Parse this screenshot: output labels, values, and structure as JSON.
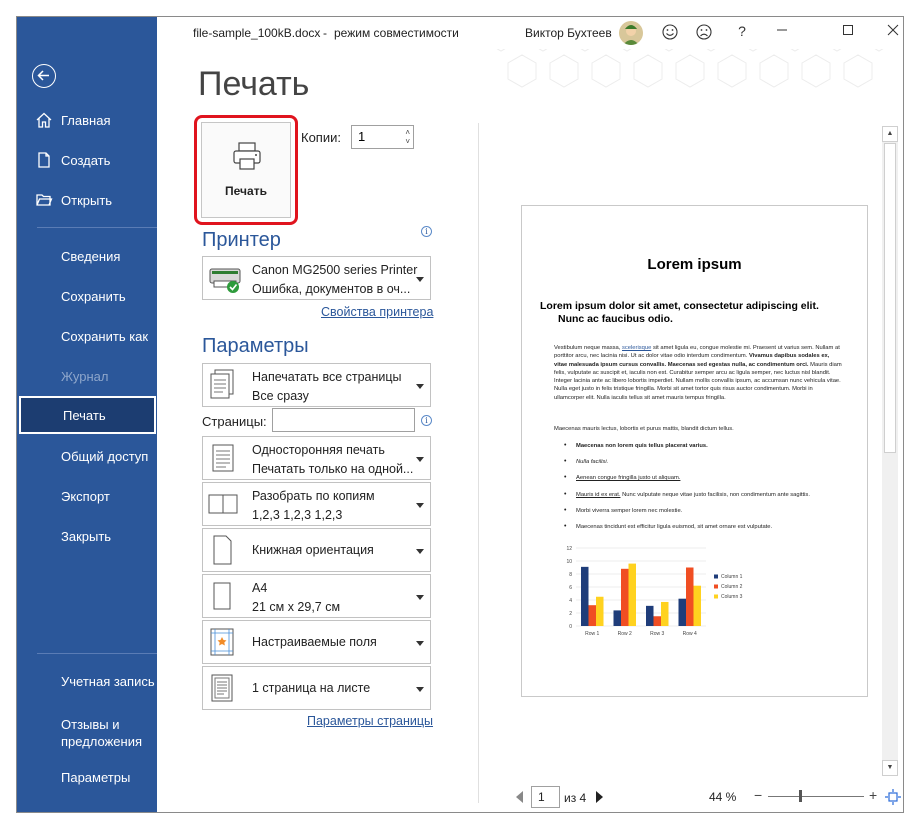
{
  "titlebar": {
    "filename": "file-sample_100kB.docx",
    "separator": "-",
    "mode": "режим совместимости",
    "user": "Виктор Бухтеев",
    "help": "?",
    "colors": {
      "sidebar": "#2b579a",
      "accent": "#2b579a",
      "highlight_box": "#e0141e"
    }
  },
  "sidebar": {
    "back_icon": "back-arrow-icon",
    "items": [
      {
        "label": "Главная",
        "icon": "home-icon"
      },
      {
        "label": "Создать",
        "icon": "new-document-icon"
      },
      {
        "label": "Открыть",
        "icon": "open-folder-icon"
      },
      {
        "label": "Сведения"
      },
      {
        "label": "Сохранить"
      },
      {
        "label": "Сохранить как"
      },
      {
        "label": "Журнал"
      },
      {
        "label": "Печать"
      },
      {
        "label": "Общий доступ"
      },
      {
        "label": "Экспорт"
      },
      {
        "label": "Закрыть"
      }
    ],
    "bottom_items": [
      {
        "label": "Учетная запись"
      },
      {
        "label_line1": "Отзывы и",
        "label_line2": "предложения"
      },
      {
        "label": "Параметры"
      }
    ]
  },
  "print": {
    "title": "Печать",
    "print_button": "Печать",
    "copies_label": "Копии:",
    "copies_value": "1",
    "printer_section": "Принтер",
    "printer_name": "Canon MG2500 series Printer",
    "printer_status": "Ошибка, документов в оч...",
    "printer_properties_link": "Свойства принтера",
    "params_section": "Параметры",
    "settings": [
      {
        "line1": "Напечатать все страницы",
        "line2": "Все сразу"
      },
      {
        "line1": "Односторонняя печать",
        "line2": "Печатать только на одной..."
      },
      {
        "line1": "Разобрать по копиям",
        "line2": "1,2,3    1,2,3    1,2,3"
      },
      {
        "line1": "Книжная ориентация"
      },
      {
        "line1": "A4",
        "line2": "21 см x 29,7 см"
      },
      {
        "line1": "Настраиваемые поля"
      },
      {
        "line1": "1 страница на листе"
      }
    ],
    "pages_label": "Страницы:",
    "page_setup_link": "Параметры страницы"
  },
  "preview": {
    "doc_title": "Lorem ipsum",
    "heading_line1": "Lorem ipsum dolor sit amet, consectetur adipiscing elit.",
    "heading_line2": "Nunc ac faucibus odio.",
    "para_prefix": "Vestibulum neque massa, ",
    "para_link": "scelerisque",
    "para_rest": " sit amet ligula eu, congue molestie mi. Praesent ut varius sem. Nullam at porttitor arcu, nec lacinia nisi. Ut ac dolor vitae odio interdum condimentum. ",
    "para_bold": "Vivamus dapibus sodales ex, vitae malesuada ipsum cursus convallis. Maecenas sed egestas nulla, ac condimentum orci.",
    "para_end": " Mauris diam felis, vulputate ac suscipit et, iaculis non est. Curabitur semper arcu ac ligula semper, nec luctus nisl blandit. Integer lacinia ante ac libero lobortis imperdiet. Nullam mollis convallis ipsum, ac accumsan nunc vehicula vitae. Nulla eget justo in felis tristique fringilla. Morbi sit amet tortor quis risus auctor condimentum. Morbi in ullamcorper elit. Nulla iaculis tellus sit amet mauris tempus fringilla.",
    "para2": "Maecenas mauris lectus, lobortis et purus mattis, blandit dictum tellus.",
    "list": [
      "Maecenas non lorem quis tellus placerat varius.",
      "Nulla facilisi.",
      "Aenean congue fringilla justo ut aliquam.",
      "Mauris id ex erat.",
      "Morbi viverra semper lorem nec molestie.",
      "Maecenas tincidunt est efficitur ligula euismod, sit amet ornare est vulputate."
    ],
    "list4_rest": " Nunc vulputate neque vitae justo facilisis, non condimentum ante sagittis.",
    "page_current": "1",
    "page_total": "из 4",
    "zoom": "44 %",
    "zoom_minus": "−",
    "zoom_plus": "+"
  },
  "chart_data": {
    "type": "bar",
    "categories": [
      "Row 1",
      "Row 2",
      "Row 3",
      "Row 4"
    ],
    "series": [
      {
        "name": "Column 1",
        "values": [
          9.1,
          2.4,
          3.1,
          4.2
        ],
        "color": "#1f3d7a"
      },
      {
        "name": "Column 2",
        "values": [
          3.2,
          8.8,
          1.5,
          9.0
        ],
        "color": "#f04e23"
      },
      {
        "name": "Column 3",
        "values": [
          4.5,
          9.6,
          3.7,
          6.2
        ],
        "color": "#ffd21f"
      }
    ],
    "ylim": [
      0,
      12
    ],
    "yticks": [
      "0",
      "2",
      "4",
      "6",
      "8",
      "10",
      "12"
    ],
    "grid": true,
    "legend": "right"
  }
}
